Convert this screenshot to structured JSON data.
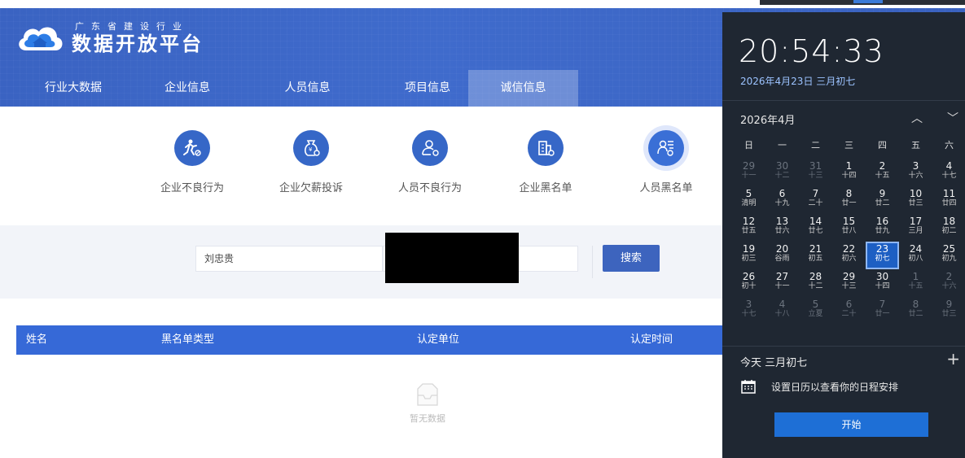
{
  "logo": {
    "sub": "广东省建设行业",
    "main": "数据开放平台"
  },
  "nav": [
    {
      "label": "行业大数据"
    },
    {
      "label": "企业信息"
    },
    {
      "label": "人员信息"
    },
    {
      "label": "项目信息"
    },
    {
      "label": "诚信信息",
      "active": true
    }
  ],
  "categories": [
    {
      "label": "企业不良行为",
      "icon": "running-person-icon"
    },
    {
      "label": "企业欠薪投诉",
      "icon": "money-bag-icon"
    },
    {
      "label": "人员不良行为",
      "icon": "person-icon"
    },
    {
      "label": "企业黑名单",
      "icon": "building-icon"
    },
    {
      "label": "人员黑名单",
      "icon": "person-list-icon",
      "active": true
    }
  ],
  "search": {
    "name_value": "刘忠贵",
    "button_label": "搜索"
  },
  "table": {
    "headers": [
      "姓名",
      "黑名单类型",
      "认定单位",
      "认定时间"
    ],
    "empty_text": "暂无数据"
  },
  "calendar": {
    "time": "20:54:33",
    "date_line": "2026年4月23日 三月初七",
    "month_title": "2026年4月",
    "weekdays": [
      "日",
      "一",
      "二",
      "三",
      "四",
      "五",
      "六"
    ],
    "weeks": [
      [
        {
          "n": "29",
          "l": "十一",
          "dim": true
        },
        {
          "n": "30",
          "l": "十二",
          "dim": true
        },
        {
          "n": "31",
          "l": "十三",
          "dim": true
        },
        {
          "n": "1",
          "l": "十四"
        },
        {
          "n": "2",
          "l": "十五"
        },
        {
          "n": "3",
          "l": "十六"
        },
        {
          "n": "4",
          "l": "十七"
        }
      ],
      [
        {
          "n": "5",
          "l": "清明"
        },
        {
          "n": "6",
          "l": "十九"
        },
        {
          "n": "7",
          "l": "二十"
        },
        {
          "n": "8",
          "l": "廿一"
        },
        {
          "n": "9",
          "l": "廿二"
        },
        {
          "n": "10",
          "l": "廿三"
        },
        {
          "n": "11",
          "l": "廿四"
        }
      ],
      [
        {
          "n": "12",
          "l": "廿五"
        },
        {
          "n": "13",
          "l": "廿六"
        },
        {
          "n": "14",
          "l": "廿七"
        },
        {
          "n": "15",
          "l": "廿八"
        },
        {
          "n": "16",
          "l": "廿九"
        },
        {
          "n": "17",
          "l": "三月"
        },
        {
          "n": "18",
          "l": "初二"
        }
      ],
      [
        {
          "n": "19",
          "l": "初三"
        },
        {
          "n": "20",
          "l": "谷雨"
        },
        {
          "n": "21",
          "l": "初五"
        },
        {
          "n": "22",
          "l": "初六"
        },
        {
          "n": "23",
          "l": "初七",
          "today": true
        },
        {
          "n": "24",
          "l": "初八"
        },
        {
          "n": "25",
          "l": "初九"
        }
      ],
      [
        {
          "n": "26",
          "l": "初十"
        },
        {
          "n": "27",
          "l": "十一"
        },
        {
          "n": "28",
          "l": "十二"
        },
        {
          "n": "29",
          "l": "十三"
        },
        {
          "n": "30",
          "l": "十四"
        },
        {
          "n": "1",
          "l": "十五",
          "dim": true
        },
        {
          "n": "2",
          "l": "十六",
          "dim": true
        }
      ],
      [
        {
          "n": "3",
          "l": "十七",
          "dim": true
        },
        {
          "n": "4",
          "l": "十八",
          "dim": true
        },
        {
          "n": "5",
          "l": "立夏",
          "dim": true
        },
        {
          "n": "6",
          "l": "二十",
          "dim": true
        },
        {
          "n": "7",
          "l": "廿一",
          "dim": true
        },
        {
          "n": "8",
          "l": "廿二",
          "dim": true
        },
        {
          "n": "9",
          "l": "廿三",
          "dim": true
        }
      ]
    ],
    "today_label": "今天 三月初七",
    "event_text": "设置日历以查看你的日程安排",
    "start_label": "开始"
  },
  "colors": {
    "header": "#3f6bcc",
    "accent": "#3669d7",
    "flyout_bg": "#1f2732",
    "today": "#1d5fc3"
  }
}
